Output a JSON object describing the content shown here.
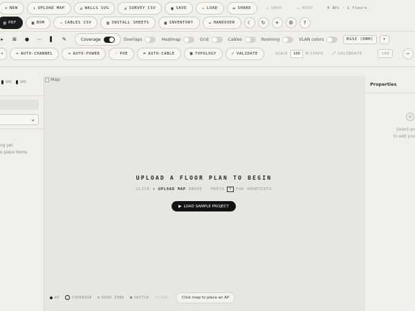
{
  "toolbar1": {
    "new": "NEW",
    "upload_map": "UPLOAD MAP",
    "walls_svg": "WALLS SVG",
    "survey_csv": "SURVEY CSV",
    "save": "SAVE",
    "load": "LOAD",
    "share": "SHARE",
    "undo": "UNDO",
    "redo": "REDO",
    "stats": "0 APs · 1 floors"
  },
  "toolbar2": {
    "pdf": "PDF",
    "bom": "BOM",
    "cables_csv": "CABLES CSV",
    "install_sheets": "INSTALL SHEETS",
    "inventory": "INVENTORY",
    "handover": "HANDOVER",
    "help": "?"
  },
  "toolbar3": {
    "coverage": "Coverage",
    "overlaps": "Overlaps",
    "heatmap": "Heatmap",
    "grid": "Grid",
    "cables": "Cables",
    "rooming": "Rooming",
    "vlan_colors": "VLAN colors",
    "rssi_select": "RSSI (DBM)"
  },
  "toolbar4": {
    "auto_channel": "AUTO-CHANNEL",
    "auto_power": "AUTO-POWER",
    "poe": "POE",
    "auto_cable": "AUTO-CABLE",
    "topology": "TOPOLOGY",
    "validate": "VALIDATE",
    "scale_label": "SCALE",
    "scale_value": "100",
    "scale_unit": "M/100PX",
    "calibrate": "CALIBRATE",
    "zoom_label": "100"
  },
  "left": {
    "ghz_a": "GHZ",
    "ghz_b": "GHZ",
    "empty1": "ng yet.",
    "empty2": "o place items."
  },
  "map": {
    "alt": "Map",
    "title": "UPLOAD A FLOOR PLAN TO BEGIN",
    "sub_click": "CLICK",
    "sub_upload": "↑ UPLOAD MAP",
    "sub_above": "ABOVE · PRESS",
    "sub_key": "?",
    "sub_shortcuts": "FOR SHORTCUTS",
    "sample": "LOAD SAMPLE PROJECT",
    "legend": {
      "ap": "AP",
      "coverage": "COVERAGE",
      "dead_zone": "DEAD ZONE",
      "switch": "SWITCH",
      "tail": "PLEAS"
    },
    "toast": "Click map to place an AP"
  },
  "right": {
    "title": "Properties",
    "hint1": "Select an",
    "hint2": "to edit prop"
  }
}
